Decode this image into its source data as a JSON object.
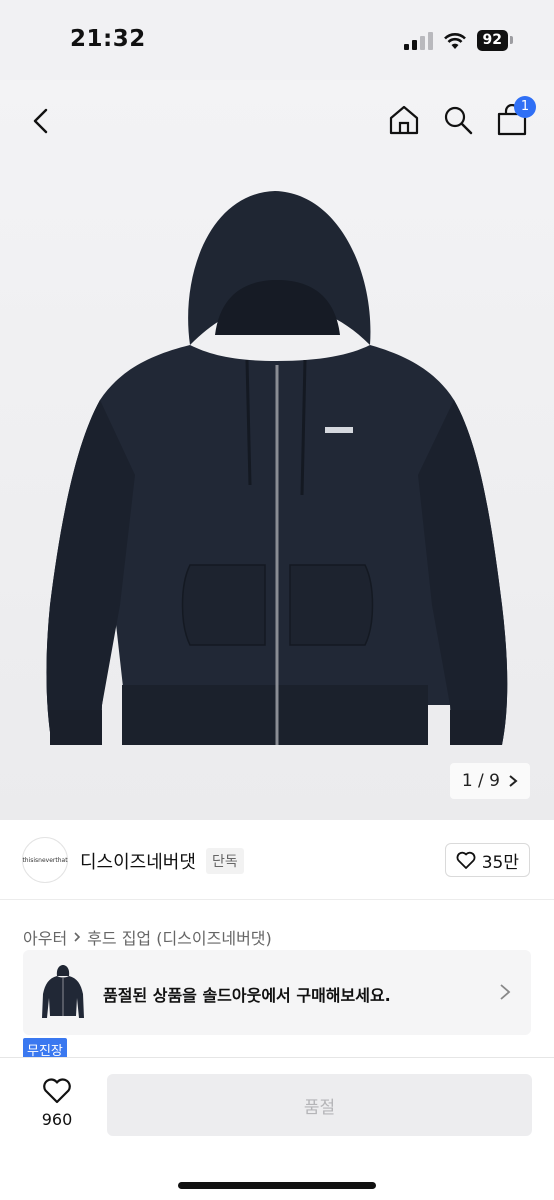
{
  "status_bar": {
    "time": "21:32",
    "battery": "92"
  },
  "header": {
    "cart_count": "1"
  },
  "gallery": {
    "counter": "1 / 9"
  },
  "brand": {
    "logo_text": "thisisneverthat",
    "name": "디스이즈네버댓",
    "tag": "단독",
    "likes": "35만"
  },
  "breadcrumb": {
    "category": "아우터",
    "sub": "후드 집업 (디스이즈네버댓)"
  },
  "soldout_banner": {
    "text": "품절된 상품을 솔드아웃에서 구매해보세요."
  },
  "badge": {
    "label": "무진장"
  },
  "bottom": {
    "wish_count": "960",
    "buy_label": "품절"
  },
  "icons": [
    "back-icon",
    "home-icon",
    "search-icon",
    "cart-icon",
    "heart-icon",
    "chevron-right-icon"
  ]
}
